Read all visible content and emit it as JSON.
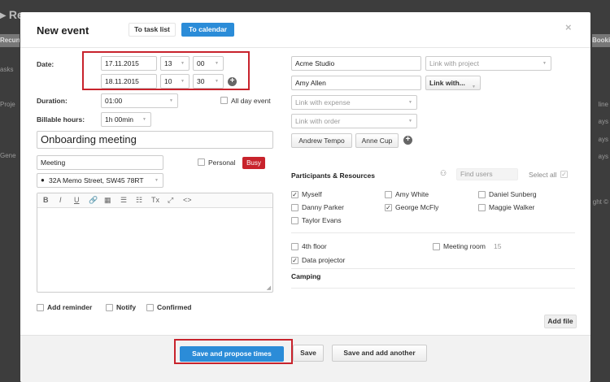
{
  "background": {
    "title": "Re",
    "tab_left": "Recurring",
    "tab_right": "Bookings",
    "left_items": [
      "asks",
      "Proje",
      "Gene"
    ],
    "right_items": [
      "line",
      "ays",
      "ays",
      "ays",
      "ght ©"
    ]
  },
  "modal": {
    "title": "New event",
    "tab_task_list": "To task list",
    "tab_calendar": "To calendar",
    "close_icon": "×"
  },
  "form": {
    "date_label": "Date:",
    "start_date": "17.11.2015",
    "start_hour": "13",
    "start_minute": "00",
    "end_date": "18.11.2015",
    "end_hour": "10",
    "end_minute": "30",
    "duration_label": "Duration:",
    "duration_value": "01:00",
    "all_day_label": "All day event",
    "billable_label": "Billable hours:",
    "billable_value": "1h 00min",
    "event_title": "Onboarding meeting",
    "event_type": "Meeting",
    "personal_label": "Personal",
    "busy_label": "Busy",
    "location": "32A Memo Street, SW45 78RT"
  },
  "editor": {
    "tools": [
      "B",
      "I",
      "U",
      "🔗",
      "▦",
      "☰",
      "☷",
      "Tx",
      "⤢",
      "<>"
    ]
  },
  "options": {
    "add_reminder": "Add reminder",
    "notify": "Notify",
    "confirmed": "Confirmed"
  },
  "right": {
    "company": "Acme Studio",
    "contact": "Amy Allen",
    "project_placeholder": "Link with project",
    "link_with": "Link with...",
    "expense_placeholder": "Link with expense",
    "order_placeholder": "Link with order",
    "tag1": "Andrew Tempo",
    "tag2": "Anne Cup"
  },
  "participants": {
    "title": "Participants & Resources",
    "search_placeholder": "Find users",
    "select_all": "Select all",
    "people": [
      {
        "name": "Myself",
        "checked": true
      },
      {
        "name": "Amy White",
        "checked": false
      },
      {
        "name": "Daniel Sunberg",
        "checked": false
      },
      {
        "name": "Danny Parker",
        "checked": false
      },
      {
        "name": "George McFly",
        "checked": true
      },
      {
        "name": "Maggie Walker",
        "checked": false
      },
      {
        "name": "Taylor Evans",
        "checked": false
      }
    ],
    "resources": [
      {
        "name": "4th floor",
        "checked": false
      },
      {
        "name": "Meeting room",
        "count": "15",
        "checked": false
      },
      {
        "name": "Data projector",
        "checked": true
      }
    ],
    "camping_title": "Camping",
    "add_file": "Add file"
  },
  "footer": {
    "save_propose": "Save and propose times",
    "save": "Save",
    "save_add_another": "Save and add another"
  },
  "colors": {
    "accent": "#2b8cd8",
    "danger": "#c8232c"
  }
}
